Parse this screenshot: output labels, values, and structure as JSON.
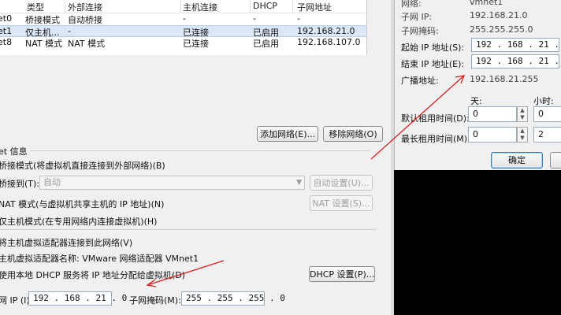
{
  "table": {
    "headers": [
      "类型",
      "外部连接",
      "主机连接",
      "DHCP",
      "子网地址"
    ],
    "rows": [
      {
        "name": "et0",
        "type": "桥接模式",
        "external": "自动桥接",
        "host": "-",
        "dhcp": "-",
        "subnet": "-"
      },
      {
        "name": "et1",
        "type": "仅主机...",
        "external": "-",
        "host": "已连接",
        "dhcp": "已启用",
        "subnet": "192.168.21.0"
      },
      {
        "name": "et8",
        "type": "NAT 模式",
        "external": "NAT 模式",
        "host": "已连接",
        "dhcp": "已启用",
        "subnet": "192.168.107.0"
      }
    ],
    "selected_row": 1
  },
  "buttons": {
    "add_network": "添加网络(E)...",
    "remove_network": "移除网络(O)",
    "auto_settings": "自动设置(U)...",
    "nat_settings": "NAT 设置(S)...",
    "dhcp_settings": "DHCP 设置(P)...",
    "ok": "确定"
  },
  "vmnet_info": {
    "group_title": "et 信息",
    "bridged_mode": "桥接模式(将虚拟机直接连接到外部网络)(B)",
    "bridged_to_label": "桥接到(T):",
    "bridged_to_value": "自动",
    "nat_mode": "NAT 模式(与虚拟机共享主机的 IP 地址)(N)",
    "host_only_mode": "仅主机模式(在专用网络内连接虚拟机)(H)",
    "connect_adapter": "将主机虚拟适配器连接到此网络(V)",
    "adapter_name": "主机虚拟适配器名称: VMware 网络适配器 VMnet1",
    "use_dhcp": "使用本地 DHCP 服务将 IP 地址分配给虚拟机(D)",
    "subnet_ip_label": "网 IP (I):",
    "subnet_ip_value": "192 . 168 . 21 . 0",
    "subnet_mask_label": "子网掩码(M):",
    "subnet_mask_value": "255 . 255 . 255 . 0"
  },
  "dhcp_dialog": {
    "network_label": "网络:",
    "network_value": "vmnet1",
    "subnet_ip_label": "子网 IP:",
    "subnet_ip_value": "192.168.21.0",
    "subnet_mask_label": "子网掩码:",
    "subnet_mask_value": "255.255.255.0",
    "start_ip_label": "起始 IP 地址(S):",
    "start_ip_value": "192 . 168 . 21 . 128",
    "end_ip_label": "结束 IP 地址(E):",
    "end_ip_value": "192 . 168 . 21 . 254",
    "broadcast_label": "广播地址:",
    "broadcast_value": "192.168.21.255",
    "days_header": "天:",
    "hours_header": "小时:",
    "default_lease_label": "默认租用时间(D):",
    "default_lease_days": "0",
    "default_lease_hours": "0",
    "max_lease_label": "最长租用时间(M):",
    "max_lease_days": "0",
    "max_lease_hours": "2"
  },
  "colors": {
    "dialog_bg": "#f0f0f0",
    "selection": "#dbe7f6",
    "annotation_arrow": "#d42020"
  }
}
